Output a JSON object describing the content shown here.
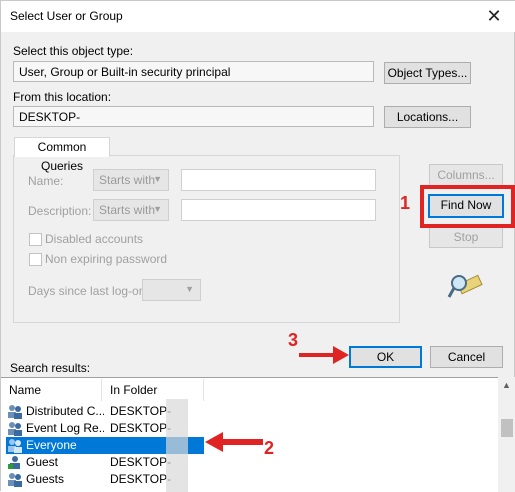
{
  "window": {
    "title": "Select User or Group",
    "close_glyph": "✕"
  },
  "object_type": {
    "label": "Select this object type:",
    "value": "User, Group or Built-in security principal",
    "button": "Object Types..."
  },
  "location": {
    "label": "From this location:",
    "value": "DESKTOP-",
    "button": "Locations..."
  },
  "common_queries": {
    "tab": "Common Queries",
    "name_label": "Name:",
    "name_op": "Starts with",
    "description_label": "Description:",
    "description_op": "Starts with",
    "disabled_accounts": "Disabled accounts",
    "non_expiring": "Non expiring password",
    "days_label": "Days since last log-on:"
  },
  "side_buttons": {
    "columns": "Columns...",
    "find_now": "Find Now",
    "stop": "Stop"
  },
  "actions": {
    "ok": "OK",
    "cancel": "Cancel"
  },
  "results": {
    "label": "Search results:",
    "columns": [
      "Name",
      "In Folder"
    ],
    "rows": [
      {
        "name": "Distributed C...",
        "folder": "DESKTOP-",
        "icon": "group-icon",
        "selected": false
      },
      {
        "name": "Event Log Re...",
        "folder": "DESKTOP-",
        "icon": "group-icon",
        "selected": false
      },
      {
        "name": "Everyone",
        "folder": "",
        "icon": "group-icon",
        "selected": true
      },
      {
        "name": "Guest",
        "folder": "DESKTOP-",
        "icon": "user-icon",
        "selected": false
      },
      {
        "name": "Guests",
        "folder": "DESKTOP-",
        "icon": "group-icon",
        "selected": false
      }
    ]
  },
  "annotations": {
    "n1": "1",
    "n2": "2",
    "n3": "3",
    "color": "#e02424"
  },
  "colors": {
    "accent": "#0078d7",
    "selection": "#0078d7"
  }
}
